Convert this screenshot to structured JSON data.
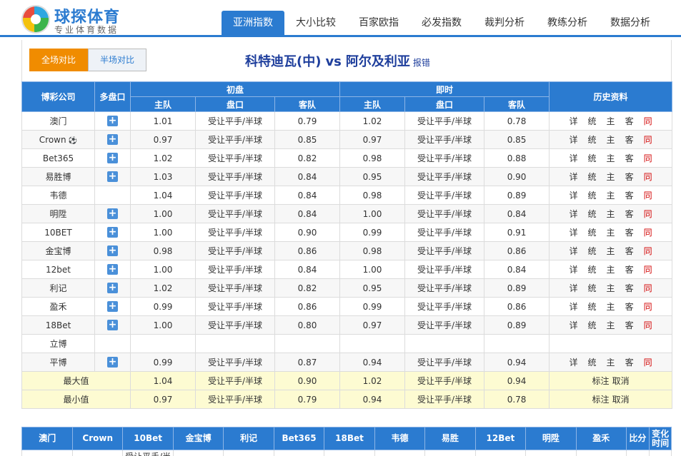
{
  "logo": {
    "title": "球探体育",
    "subtitle": "专业体育数据"
  },
  "nav": [
    "亚洲指数",
    "大小比较",
    "百家欧指",
    "必发指数",
    "裁判分析",
    "教练分析",
    "数据分析"
  ],
  "toolbar": {
    "full": "全场对比",
    "half": "半场对比"
  },
  "match": {
    "home": "科特迪瓦(中)",
    "vs": "vs",
    "away": "阿尔及利亚",
    "report": "报错"
  },
  "table": {
    "h_company": "博彩公司",
    "h_multi": "多盘口",
    "h_initial": "初盘",
    "h_live": "即时",
    "h_history": "历史资料",
    "h_home": "主队",
    "h_line": "盘口",
    "h_away": "客队"
  },
  "rows": [
    {
      "company": "澳门",
      "plus": true,
      "i_home": "1.01",
      "i_line": "受让平手/半球",
      "i_away": "0.79",
      "l_home": "1.02",
      "l_line": "受让平手/半球",
      "l_away": "0.78",
      "hist": true
    },
    {
      "company": "Crown",
      "ball": true,
      "plus": true,
      "i_home": "0.97",
      "i_line": "受让平手/半球",
      "i_away": "0.85",
      "l_home": "0.97",
      "l_line": "受让平手/半球",
      "l_away": "0.85",
      "hist": true
    },
    {
      "company": "Bet365",
      "plus": true,
      "i_home": "1.02",
      "i_line": "受让平手/半球",
      "i_away": "0.82",
      "l_home": "0.98",
      "l_line": "受让平手/半球",
      "l_away": "0.88",
      "hist": true
    },
    {
      "company": "易胜博",
      "plus": true,
      "i_home": "1.03",
      "i_line": "受让平手/半球",
      "i_away": "0.84",
      "l_home": "0.95",
      "l_line": "受让平手/半球",
      "l_away": "0.90",
      "hist": true
    },
    {
      "company": "韦德",
      "plus": false,
      "i_home": "1.04",
      "i_line": "受让平手/半球",
      "i_away": "0.84",
      "l_home": "0.98",
      "l_line": "受让平手/半球",
      "l_away": "0.89",
      "hist": true
    },
    {
      "company": "明陞",
      "plus": true,
      "i_home": "1.00",
      "i_line": "受让平手/半球",
      "i_away": "0.84",
      "l_home": "1.00",
      "l_line": "受让平手/半球",
      "l_away": "0.84",
      "hist": true
    },
    {
      "company": "10BET",
      "plus": true,
      "i_home": "1.00",
      "i_line": "受让平手/半球",
      "i_away": "0.90",
      "l_home": "0.99",
      "l_line": "受让平手/半球",
      "l_away": "0.91",
      "hist": true
    },
    {
      "company": "金宝博",
      "plus": true,
      "i_home": "0.98",
      "i_line": "受让平手/半球",
      "i_away": "0.86",
      "l_home": "0.98",
      "l_line": "受让平手/半球",
      "l_away": "0.86",
      "hist": true
    },
    {
      "company": "12bet",
      "plus": true,
      "i_home": "1.00",
      "i_line": "受让平手/半球",
      "i_away": "0.84",
      "l_home": "1.00",
      "l_line": "受让平手/半球",
      "l_away": "0.84",
      "hist": true
    },
    {
      "company": "利记",
      "plus": true,
      "i_home": "1.02",
      "i_line": "受让平手/半球",
      "i_away": "0.82",
      "l_home": "0.95",
      "l_line": "受让平手/半球",
      "l_away": "0.89",
      "hist": true
    },
    {
      "company": "盈禾",
      "plus": true,
      "i_home": "0.99",
      "i_line": "受让平手/半球",
      "i_away": "0.86",
      "l_home": "0.99",
      "l_line": "受让平手/半球",
      "l_away": "0.86",
      "hist": true
    },
    {
      "company": "18Bet",
      "plus": true,
      "i_home": "1.00",
      "i_line": "受让平手/半球",
      "i_away": "0.80",
      "l_home": "0.97",
      "l_line": "受让平手/半球",
      "l_away": "0.89",
      "hist": true
    },
    {
      "company": "立博",
      "plus": false,
      "i_home": "",
      "i_line": "",
      "i_away": "",
      "l_home": "",
      "l_line": "",
      "l_away": "",
      "hist": false
    },
    {
      "company": "平博",
      "plus": true,
      "i_home": "0.99",
      "i_line": "受让平手/半球",
      "i_away": "0.87",
      "l_home": "0.94",
      "l_line": "受让平手/半球",
      "l_away": "0.94",
      "hist": true
    }
  ],
  "history_links": [
    "详",
    "统",
    "主",
    "客",
    "同"
  ],
  "stats": [
    {
      "label": "最大值",
      "i_home": "1.04",
      "i_line": "受让平手/半球",
      "i_away": "0.90",
      "l_home": "1.02",
      "l_line": "受让平手/半球",
      "l_away": "0.94",
      "mark": "标注",
      "cancel": "取消"
    },
    {
      "label": "最小值",
      "i_home": "0.97",
      "i_line": "受让平手/半球",
      "i_away": "0.79",
      "l_home": "0.94",
      "l_line": "受让平手/半球",
      "l_away": "0.78",
      "mark": "标注",
      "cancel": "取消"
    }
  ],
  "bottom": {
    "headers": [
      "澳门",
      "Crown",
      "10Bet",
      "金宝博",
      "利记",
      "Bet365",
      "18Bet",
      "韦德",
      "易胜",
      "12Bet",
      "明陞",
      "盈禾",
      "比分",
      "变化时间"
    ],
    "partial_cell": "受让平手/半"
  },
  "colors": {
    "accent": "#2b7bd0",
    "active_toggle": "#f08c00",
    "stat_row": "#fdfbd2",
    "history_red": "#d20000"
  }
}
